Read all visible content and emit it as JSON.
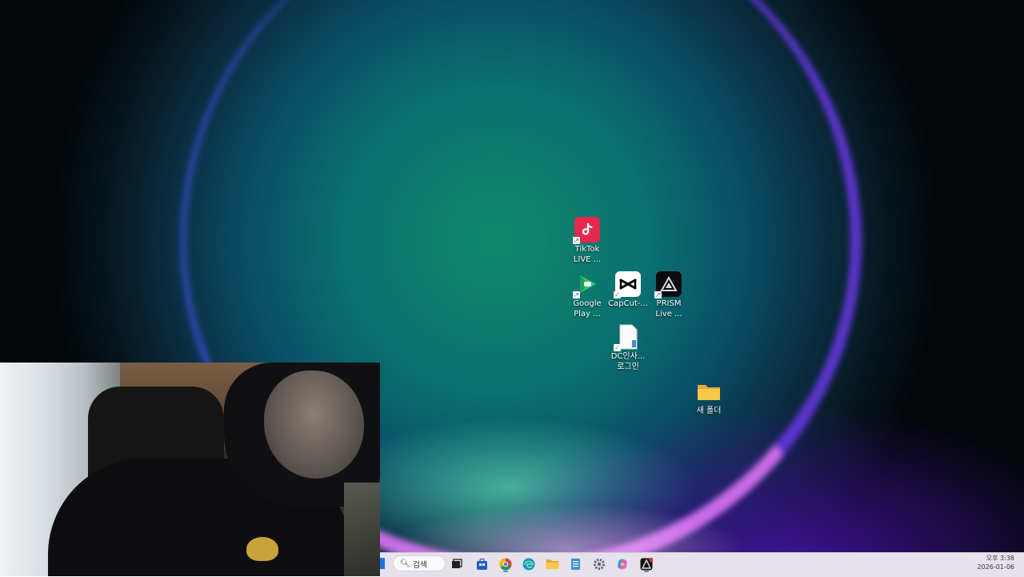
{
  "desktop": {
    "icons": [
      {
        "label_line1": "TikTok",
        "label_line2": "LIVE ...",
        "icon": "tiktok-live-icon"
      },
      {
        "label_line1": "Google",
        "label_line2": "Play ...",
        "icon": "google-play-games-icon"
      },
      {
        "label_line1": "CapCut-...",
        "label_line2": "",
        "icon": "capcut-icon"
      },
      {
        "label_line1": "PRISM",
        "label_line2": "Live ...",
        "icon": "prism-live-icon"
      },
      {
        "label_line1": "DC인사...",
        "label_line2": "로그인",
        "icon": "text-file-icon"
      },
      {
        "label_line1": "새 폴더",
        "label_line2": "",
        "icon": "folder-icon"
      }
    ]
  },
  "taskbar": {
    "search_label": "검색",
    "items": [
      {
        "icon": "task-view-icon"
      },
      {
        "icon": "microsoft-store-icon"
      },
      {
        "icon": "chrome-icon"
      },
      {
        "icon": "edge-icon"
      },
      {
        "icon": "file-explorer-icon"
      },
      {
        "icon": "notepad-icon"
      },
      {
        "icon": "settings-gear-icon"
      },
      {
        "icon": "copilot-icon"
      },
      {
        "icon": "prism-live-taskbar-icon"
      }
    ],
    "clock": {
      "time": "오후 3:38",
      "date": "2026-01-06"
    }
  },
  "colors": {
    "taskbar_bg": "#e6e2ec",
    "tiktok_bg": "#e5284e",
    "folder_yellow": "#f7c948"
  }
}
